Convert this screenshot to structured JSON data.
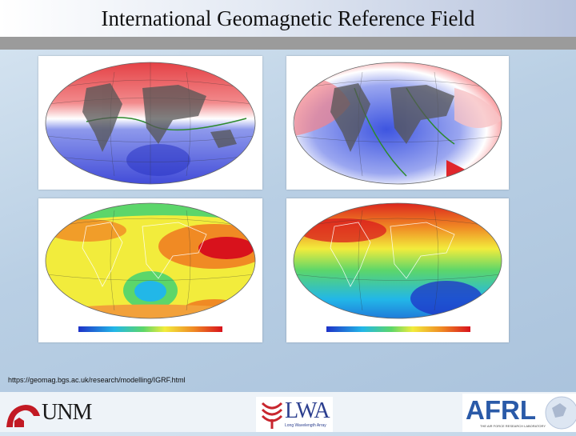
{
  "title": "International Geomagnetic Reference Field",
  "source_url": "https://geomag.bgs.ac.uk/research/modelling/IGRF.html",
  "panels": [
    {
      "name": "declination-map",
      "colors": [
        "#ffffff",
        "#e2363a",
        "#3a44d6"
      ]
    },
    {
      "name": "inclination-map",
      "colors": [
        "#ffffff",
        "#f3494f",
        "#3e55e0"
      ]
    },
    {
      "name": "total-intensity-map",
      "colors": [
        "#1e32c8",
        "#22b7e8",
        "#5cd66a",
        "#f2ec3c",
        "#f08a24",
        "#d8121c"
      ]
    },
    {
      "name": "vertical-component-map",
      "colors": [
        "#1e32c8",
        "#22b7e8",
        "#5cd66a",
        "#f2ec3c",
        "#f08a24",
        "#d8121c"
      ]
    }
  ],
  "logos": {
    "unm": "UNM",
    "lwa": "LWA",
    "lwa_sub": "Long Wavelength Array",
    "afrl": "AFRL",
    "afrl_sub": "THE AIR FORCE RESEARCH LABORATORY"
  },
  "colors": {
    "unm_red": "#c21a24",
    "lwa_red": "#c8262e",
    "afrl_blue": "#2a5aa8"
  }
}
